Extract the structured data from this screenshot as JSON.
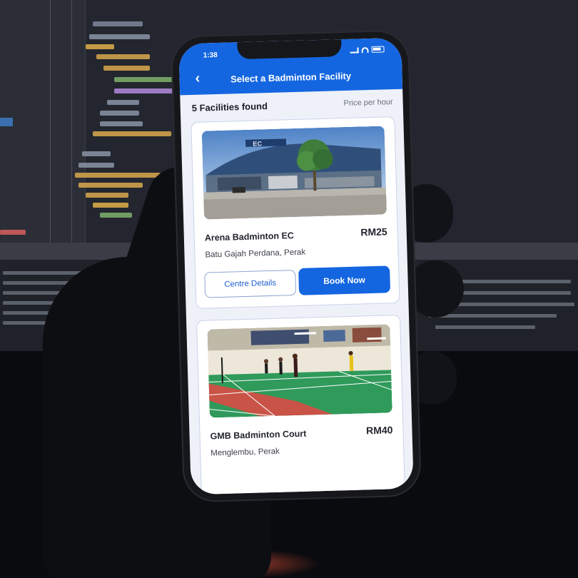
{
  "status_bar": {
    "time": "1:38"
  },
  "appbar": {
    "back_icon": "chevron-left-icon",
    "title": "Select a Badminton Facility"
  },
  "list": {
    "count_label": "5 Facilities found",
    "price_note": "Price per hour"
  },
  "facilities": [
    {
      "name": "Arena Badminton EC",
      "price": "RM25",
      "location": "Batu Gajah Perdana, Perak",
      "details_label": "Centre Details",
      "book_label": "Book Now",
      "photo": "building-exterior-photo"
    },
    {
      "name": "GMB Badminton Court",
      "price": "RM40",
      "location": "Menglembu, Perak",
      "photo": "indoor-court-photo"
    }
  ],
  "colors": {
    "primary": "#1466e0",
    "card_border": "#c9d3ea",
    "screen_bg": "#eef1f8",
    "court_green": "#2f9a5a",
    "court_red": "#c85346"
  }
}
